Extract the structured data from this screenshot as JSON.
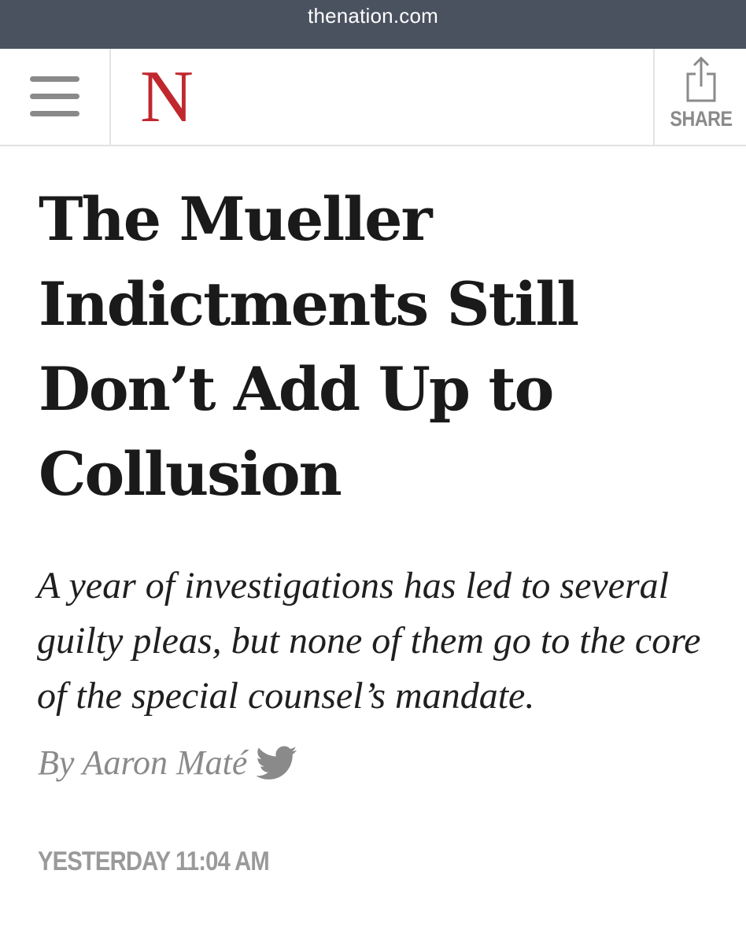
{
  "browser": {
    "url": "thenation.com"
  },
  "header": {
    "logo_text": "N",
    "share_label": "SHARE"
  },
  "article": {
    "headline": "The Mueller Indictments Still Don’t Add Up to Collusion",
    "deck": "A year of investigations has led to several guilty pleas, but none of them go to the core of the special counsel’s mandate.",
    "byline": "By Aaron Maté",
    "timestamp": "YESTERDAY 11:04 AM"
  },
  "colors": {
    "url_bar": "#4a5260",
    "logo_red": "#c0282e",
    "muted_gray": "#8a8a8a"
  }
}
